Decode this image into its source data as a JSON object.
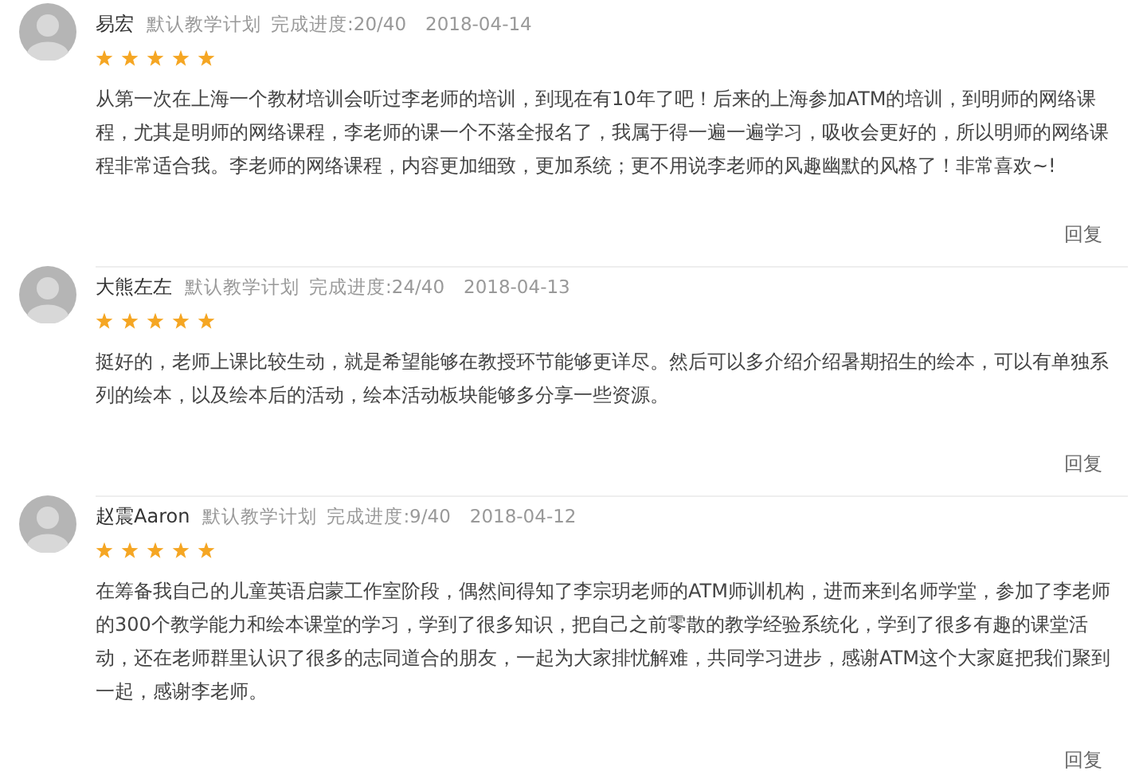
{
  "reviews": [
    {
      "name": "易宏",
      "plan": "默认教学计划",
      "progress": "完成进度:20/40",
      "date": "2018-04-14",
      "stars": 5,
      "text": "从第一次在上海一个教材培训会听过李老师的培训，到现在有10年了吧！后来的上海参加ATM的培训，到明师的网络课程，尤其是明师的网络课程，李老师的课一个不落全报名了，我属于得一遍一遍学习，吸收会更好的，所以明师的网络课程非常适合我。李老师的网络课程，内容更加细致，更加系统；更不用说李老师的风趣幽默的风格了！非常喜欢~!",
      "reply": "回复"
    },
    {
      "name": "大熊左左",
      "plan": "默认教学计划",
      "progress": "完成进度:24/40",
      "date": "2018-04-13",
      "stars": 5,
      "text": "挺好的，老师上课比较生动，就是希望能够在教授环节能够更详尽。然后可以多介绍介绍暑期招生的绘本，可以有单独系列的绘本，以及绘本后的活动，绘本活动板块能够多分享一些资源。",
      "reply": "回复"
    },
    {
      "name": "赵震Aaron",
      "plan": "默认教学计划",
      "progress": "完成进度:9/40",
      "date": "2018-04-12",
      "stars": 5,
      "text": "在筹备我自己的儿童英语启蒙工作室阶段，偶然间得知了李宗玥老师的ATM师训机构，进而来到名师学堂，参加了李老师的300个教学能力和绘本课堂的学习，学到了很多知识，把自己之前零散的教学经验系统化，学到了很多有趣的课堂活动，还在老师群里认识了很多的志同道合的朋友，一起为大家排忧解难，共同学习进步，感谢ATM这个大家庭把我们聚到一起，感谢李老师。",
      "reply": "回复"
    }
  ]
}
